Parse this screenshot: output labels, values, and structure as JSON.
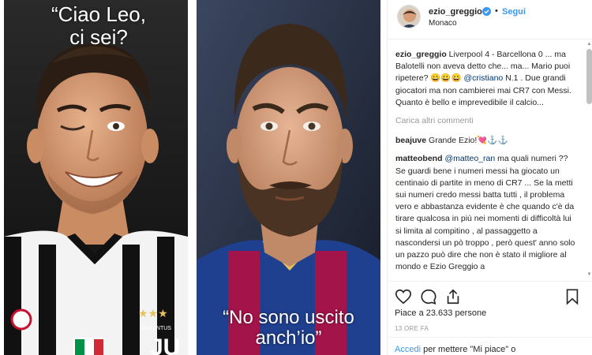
{
  "media": {
    "left_caption": "“Ciao Leo,\nci sei?",
    "right_caption": "“No sono uscito\nanch’io”"
  },
  "header": {
    "username": "ezio_greggio",
    "separator": "•",
    "follow_label": "Segui",
    "location": "Monaco"
  },
  "caption": {
    "user": "ezio_greggio",
    "text_a": " Liverpool 4 - Barcellona 0 ... ma Balotelli non aveva detto che... ma... Mario puoi ripetere? 😀😀😀 ",
    "mention": "@cristiano",
    "text_b": " N.1 . Due grandi giocatori ma non cambierei mai CR7 con Messi. Quanto è bello e imprevedibile il calcio..."
  },
  "load_more_label": "Carica altri commenti",
  "comments": [
    {
      "user": "beajuve",
      "text": " Grande Ezio!💘⚓⚓"
    },
    {
      "user": "matteobend",
      "mention": "@matteo_ran",
      "text": " ma quali numeri ?? Se guardi bene i numeri messi ha giocato un centinaio di partite in meno di CR7 ... Se la metti sui numeri credo messi batta tutti , il problema vero e abbastanza evidente è che quando c'è da tirare qualcosa in più nei momenti di difficoltà lui si limita al compitino , al passaggetto a nascondersi un pò troppo , però quest' anno solo un pazzo può dire che non è stato il migliore al mondo e Ezio Greggio a"
    }
  ],
  "likes": {
    "text": "Piace a 23.633 persone"
  },
  "time": "13 ORE FA",
  "login": {
    "link": "Accedi",
    "text": " per mettere \"Mi piace\" o"
  },
  "icons": {
    "like": "heart-icon",
    "comment": "comment-icon",
    "share": "share-icon",
    "save": "bookmark-icon",
    "verified": "verified-badge-icon"
  },
  "colors": {
    "accent": "#3897f0",
    "mention": "#003569",
    "muted": "#999999",
    "border": "#efefef",
    "juve_black": "#111111",
    "barca_blue": "#1f3f8f",
    "barca_red": "#a3154a"
  }
}
